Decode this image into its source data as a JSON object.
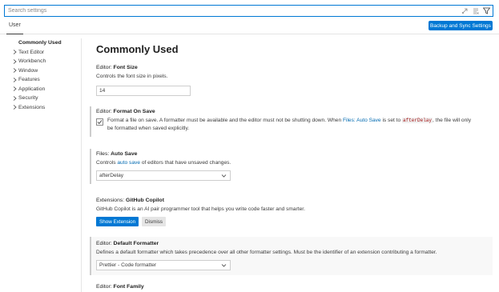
{
  "search": {
    "placeholder": "Search settings",
    "value": ""
  },
  "tabs": {
    "user": "User"
  },
  "sync_button": "Backup and Sync Settings",
  "toc": {
    "active": "Commonly Used",
    "items": [
      "Text Editor",
      "Workbench",
      "Window",
      "Features",
      "Application",
      "Security",
      "Extensions"
    ]
  },
  "page_title": "Commonly Used",
  "settings": {
    "font_size": {
      "category": "Editor: ",
      "name": "Font Size",
      "description": "Controls the font size in pixels.",
      "value": "14"
    },
    "format_on_save": {
      "category": "Editor: ",
      "name": "Format On Save",
      "desc_part1": "Format a file on save. A formatter must be available and the editor must not be shutting down. When ",
      "desc_link": "Files: Auto Save",
      "desc_part2": " is set to ",
      "desc_code": "afterDelay",
      "desc_part3": ", the file will only",
      "desc_line2": "be formatted when saved explicitly.",
      "checked": true
    },
    "auto_save": {
      "category": "Files: ",
      "name": "Auto Save",
      "desc_part1": "Controls ",
      "desc_link": "auto save",
      "desc_part2": " of editors that have unsaved changes.",
      "value": "afterDelay"
    },
    "copilot": {
      "category": "Extensions: ",
      "name": "GitHub Copilot",
      "description": "GitHub Copilot is an AI pair programmer tool that helps you write code faster and smarter.",
      "show_button": "Show Extension",
      "dismiss_button": "Dismiss"
    },
    "default_formatter": {
      "category": "Editor: ",
      "name": "Default Formatter",
      "description": "Defines a default formatter which takes precedence over all other formatter settings. Must be the identifier of an extension contributing a formatter.",
      "value": "Prettier - Code formatter"
    },
    "font_family": {
      "category": "Editor: ",
      "name": "Font Family"
    }
  },
  "colors": {
    "accent": "#0078d4",
    "link": "#006ab1"
  }
}
